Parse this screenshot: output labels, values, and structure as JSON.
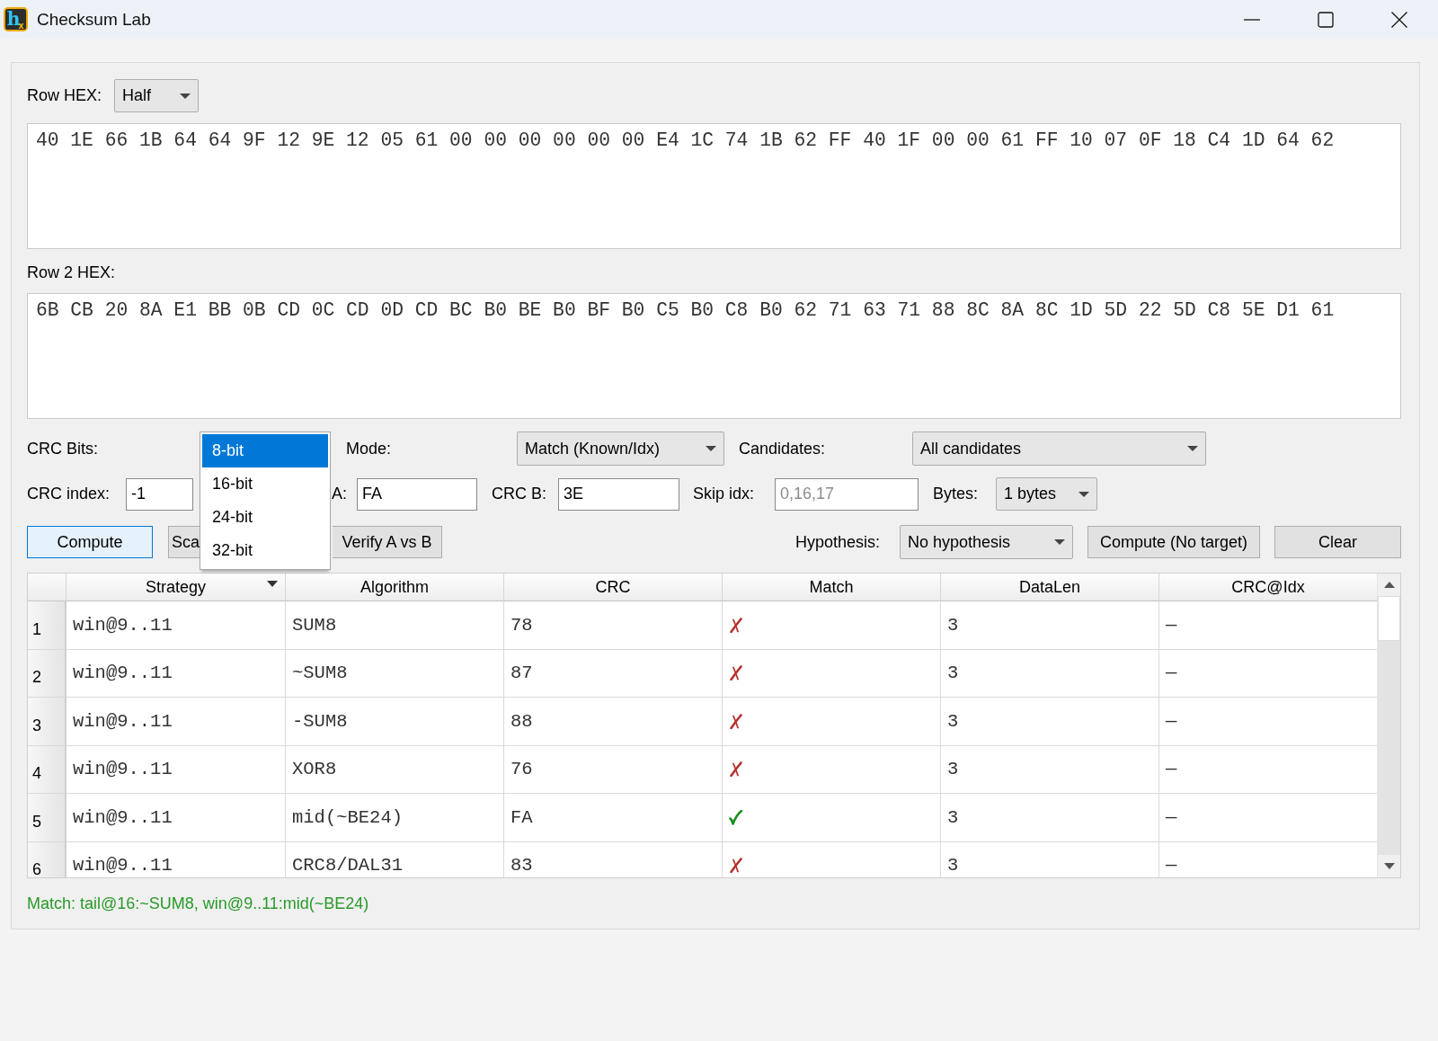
{
  "window": {
    "title": "Checksum Lab",
    "app_icon": {
      "glyph": "h",
      "subscript": "x"
    }
  },
  "row_hex": {
    "label": "Row HEX:",
    "mode": "Half",
    "value": "40 1E 66 1B 64 64 9F 12 9E 12 05 61 00 00 00 00 00 00 E4 1C 74 1B 62 FF 40 1F 00 00 61 FF 10 07 0F 18 C4 1D 64 62"
  },
  "row2_hex": {
    "label": "Row 2 HEX:",
    "value": "6B CB 20 8A E1 BB 0B CD 0C CD 0D CD BC B0 BE B0 BF B0 C5 B0 C8 B0 62 71 63 71 88 8C 8A 8C 1D 5D 22 5D C8 5E D1 61"
  },
  "crc_bits": {
    "label": "CRC Bits:",
    "options": [
      {
        "label": "8-bit",
        "selected": true
      },
      {
        "label": "16-bit",
        "selected": false
      },
      {
        "label": "24-bit",
        "selected": false
      },
      {
        "label": "32-bit",
        "selected": false
      }
    ]
  },
  "mode": {
    "label": "Mode:",
    "value": "Match (Known/Idx)"
  },
  "candidates": {
    "label": "Candidates:",
    "value": "All candidates"
  },
  "crc_index": {
    "label": "CRC index:",
    "value": "-1"
  },
  "crc_a": {
    "label": "A:",
    "value": "FA"
  },
  "crc_b": {
    "label": "CRC B:",
    "value": "3E"
  },
  "skip_idx": {
    "label": "Skip idx:",
    "placeholder": "0,16,17"
  },
  "bytes": {
    "label": "Bytes:",
    "value": "1 bytes"
  },
  "buttons_left": [
    {
      "label": "Compute",
      "focused": true
    },
    {
      "label": "Sca",
      "focused": false
    },
    {
      "label": "Verify A vs B",
      "focused": false
    }
  ],
  "hypothesis": {
    "label": "Hypothesis:",
    "value": "No hypothesis"
  },
  "buttons_right": [
    {
      "label": "Compute (No target)"
    },
    {
      "label": "Clear"
    }
  ],
  "table": {
    "columns": [
      {
        "label": "Strategy",
        "sorted": true
      },
      {
        "label": "Algorithm",
        "sorted": false
      },
      {
        "label": "CRC",
        "sorted": false
      },
      {
        "label": "Match",
        "sorted": false
      },
      {
        "label": "DataLen",
        "sorted": false
      },
      {
        "label": "CRC@Idx",
        "sorted": false
      }
    ],
    "rows": [
      {
        "number": "1",
        "strategy": "win@9..11",
        "algorithm": "SUM8",
        "crc": "78",
        "match": false,
        "data_len": "3",
        "crc_at_idx": "—"
      },
      {
        "number": "2",
        "strategy": "win@9..11",
        "algorithm": "~SUM8",
        "crc": "87",
        "match": false,
        "data_len": "3",
        "crc_at_idx": "—"
      },
      {
        "number": "3",
        "strategy": "win@9..11",
        "algorithm": "-SUM8",
        "crc": "88",
        "match": false,
        "data_len": "3",
        "crc_at_idx": "—"
      },
      {
        "number": "4",
        "strategy": "win@9..11",
        "algorithm": "XOR8",
        "crc": "76",
        "match": false,
        "data_len": "3",
        "crc_at_idx": "—"
      },
      {
        "number": "5",
        "strategy": "win@9..11",
        "algorithm": "mid(~BE24)",
        "crc": "FA",
        "match": true,
        "data_len": "3",
        "crc_at_idx": "—"
      },
      {
        "number": "6",
        "strategy": "win@9..11",
        "algorithm": "CRC8/DAL31",
        "crc": "83",
        "match": false,
        "data_len": "3",
        "crc_at_idx": "—"
      }
    ]
  },
  "status": {
    "text": "Match: tail@16:~SUM8, win@9..11:mid(~BE24)"
  }
}
